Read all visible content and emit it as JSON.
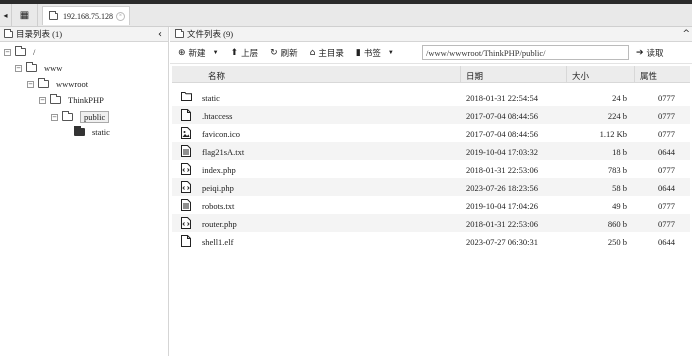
{
  "topbar": {
    "tab_title": "192.168.75.128",
    "tab_close": "×",
    "prev_glyph": "◂",
    "grid_glyph": "▦"
  },
  "left_panel": {
    "title": "目录列表 (1)",
    "collapse_glyph": "‹",
    "tree": [
      {
        "label": "/",
        "level": 0,
        "expanded": true
      },
      {
        "label": "www",
        "level": 1,
        "expanded": true
      },
      {
        "label": "wwwroot",
        "level": 2,
        "expanded": true
      },
      {
        "label": "ThinkPHP",
        "level": 3,
        "expanded": true
      },
      {
        "label": "public",
        "level": 4,
        "expanded": true,
        "selected": true
      },
      {
        "label": "static",
        "level": 5,
        "expanded": false
      }
    ]
  },
  "right_panel": {
    "title": "文件列表 (9)",
    "toolbar": {
      "new_label": "新建",
      "up_label": "上层",
      "refresh_label": "刷新",
      "home_label": "主目录",
      "bookmark_label": "书签",
      "path_value": "/www/wwwroot/ThinkPHP/public/",
      "read_label": "读取"
    },
    "columns": {
      "name": "名称",
      "date": "日期",
      "size": "大小",
      "attr": "属性"
    },
    "files": [
      {
        "icon": "folder-icon",
        "name": "static",
        "date": "2018-01-31 22:54:54",
        "size": "24 b",
        "attr": "0777"
      },
      {
        "icon": "file-icon",
        "name": ".htaccess",
        "date": "2017-07-04 08:44:56",
        "size": "224 b",
        "attr": "0777"
      },
      {
        "icon": "image-file-icon",
        "name": "favicon.ico",
        "date": "2017-07-04 08:44:56",
        "size": "1.12 Kb",
        "attr": "0777"
      },
      {
        "icon": "text-file-icon",
        "name": "flag21sA.txt",
        "date": "2019-10-04 17:03:32",
        "size": "18 b",
        "attr": "0644"
      },
      {
        "icon": "code-file-icon",
        "name": "index.php",
        "date": "2018-01-31 22:53:06",
        "size": "783 b",
        "attr": "0777"
      },
      {
        "icon": "code-file-icon",
        "name": "peiqi.php",
        "date": "2023-07-26 18:23:56",
        "size": "58 b",
        "attr": "0644"
      },
      {
        "icon": "text-file-icon",
        "name": "robots.txt",
        "date": "2019-10-04 17:04:26",
        "size": "49 b",
        "attr": "0777"
      },
      {
        "icon": "code-file-icon",
        "name": "router.php",
        "date": "2018-01-31 22:53:06",
        "size": "860 b",
        "attr": "0777"
      },
      {
        "icon": "file-icon",
        "name": "shell1.elf",
        "date": "2023-07-27 06:30:31",
        "size": "250 b",
        "attr": "0644"
      }
    ]
  }
}
